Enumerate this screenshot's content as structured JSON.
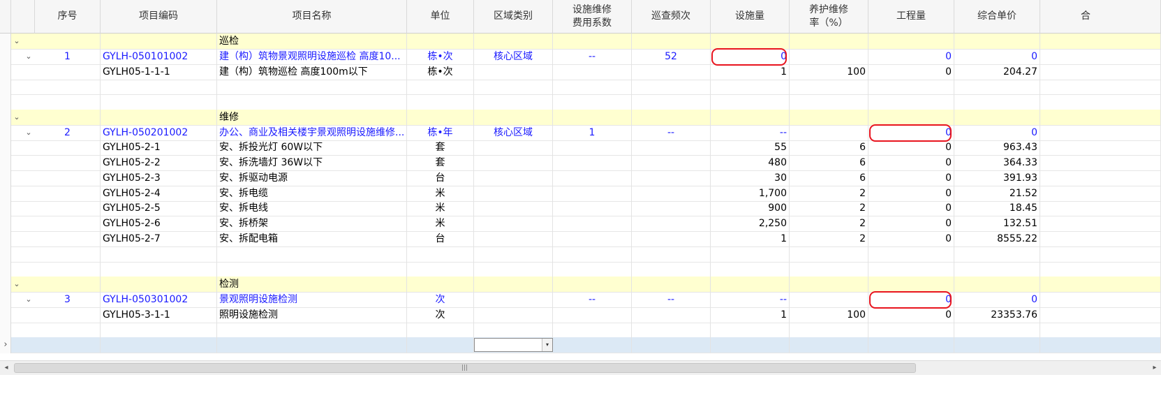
{
  "headers": [
    "序号",
    "项目编码",
    "项目名称",
    "单位",
    "区域类别",
    "设施维修\n费用系数",
    "巡查频次",
    "设施量",
    "养护维修\n率（%）",
    "工程量",
    "综合单价",
    "合"
  ],
  "rows": [
    {
      "kind": "group",
      "label": "巡检"
    },
    {
      "kind": "item",
      "seq": "1",
      "code": "GYLH-050101002",
      "name": "建（构）筑物景观照明设施巡检 高度10...",
      "unit": "栋•次",
      "region": "核心区域",
      "coef": "--",
      "freq": "52",
      "qty": "0",
      "rate": "",
      "eng": "0",
      "price": "0"
    },
    {
      "kind": "child",
      "code": "GYLH05-1-1-1",
      "name": "建（构）筑物巡检 高度100m以下",
      "unit": "栋•次",
      "qty": "1",
      "rate": "100",
      "eng": "0",
      "price": "204.27"
    },
    {
      "kind": "blank"
    },
    {
      "kind": "blank"
    },
    {
      "kind": "group",
      "label": "维修"
    },
    {
      "kind": "item",
      "seq": "2",
      "code": "GYLH-050201002",
      "name": "办公、商业及相关楼宇景观照明设施维修...",
      "unit": "栋•年",
      "region": "核心区域",
      "coef": "1",
      "freq": "--",
      "qty": "--",
      "rate": "",
      "eng": "0",
      "price": "0"
    },
    {
      "kind": "child",
      "code": "GYLH05-2-1",
      "name": "安、拆投光灯 60W以下",
      "unit": "套",
      "qty": "55",
      "rate": "6",
      "eng": "0",
      "price": "963.43"
    },
    {
      "kind": "child",
      "code": "GYLH05-2-2",
      "name": "安、拆洗墙灯 36W以下",
      "unit": "套",
      "qty": "480",
      "rate": "6",
      "eng": "0",
      "price": "364.33"
    },
    {
      "kind": "child",
      "code": "GYLH05-2-3",
      "name": "安、拆驱动电源",
      "unit": "台",
      "qty": "30",
      "rate": "6",
      "eng": "0",
      "price": "391.93"
    },
    {
      "kind": "child",
      "code": "GYLH05-2-4",
      "name": "安、拆电缆",
      "unit": "米",
      "qty": "1,700",
      "rate": "2",
      "eng": "0",
      "price": "21.52"
    },
    {
      "kind": "child",
      "code": "GYLH05-2-5",
      "name": "安、拆电线",
      "unit": "米",
      "qty": "900",
      "rate": "2",
      "eng": "0",
      "price": "18.45"
    },
    {
      "kind": "child",
      "code": "GYLH05-2-6",
      "name": "安、拆桥架",
      "unit": "米",
      "qty": "2,250",
      "rate": "2",
      "eng": "0",
      "price": "132.51"
    },
    {
      "kind": "child",
      "code": "GYLH05-2-7",
      "name": "安、拆配电箱",
      "unit": "台",
      "qty": "1",
      "rate": "2",
      "eng": "0",
      "price": "8555.22"
    },
    {
      "kind": "blank"
    },
    {
      "kind": "blank"
    },
    {
      "kind": "group",
      "label": "检测"
    },
    {
      "kind": "item",
      "seq": "3",
      "code": "GYLH-050301002",
      "name": "景观照明设施检测",
      "unit": "次",
      "region": "",
      "coef": "--",
      "freq": "--",
      "qty": "--",
      "rate": "",
      "eng": "0",
      "price": "0"
    },
    {
      "kind": "child",
      "code": "GYLH05-3-1-1",
      "name": "照明设施检测",
      "unit": "次",
      "qty": "1",
      "rate": "100",
      "eng": "0",
      "price": "23353.76"
    },
    {
      "kind": "blank"
    },
    {
      "kind": "selected"
    }
  ],
  "icons": {
    "expand": "chevron-down-icon",
    "collapse_gutter": "chevron-right-icon",
    "scroll_left": "arrow-left-icon",
    "scroll_right": "arrow-right-icon",
    "scroll_grip": "grip-icon",
    "dropdown": "dropdown-icon"
  },
  "colors": {
    "group_row_bg": "#ffffd0",
    "selected_row_bg": "#dce9f5",
    "link_text": "#1a1aff",
    "highlight": "#e8141e"
  },
  "glyphs": {
    "chevron_down": "⌄",
    "chevron_right": "›",
    "arrow_left": "◂",
    "arrow_right": "▸",
    "grip": "|||",
    "dropdown": "▾"
  }
}
